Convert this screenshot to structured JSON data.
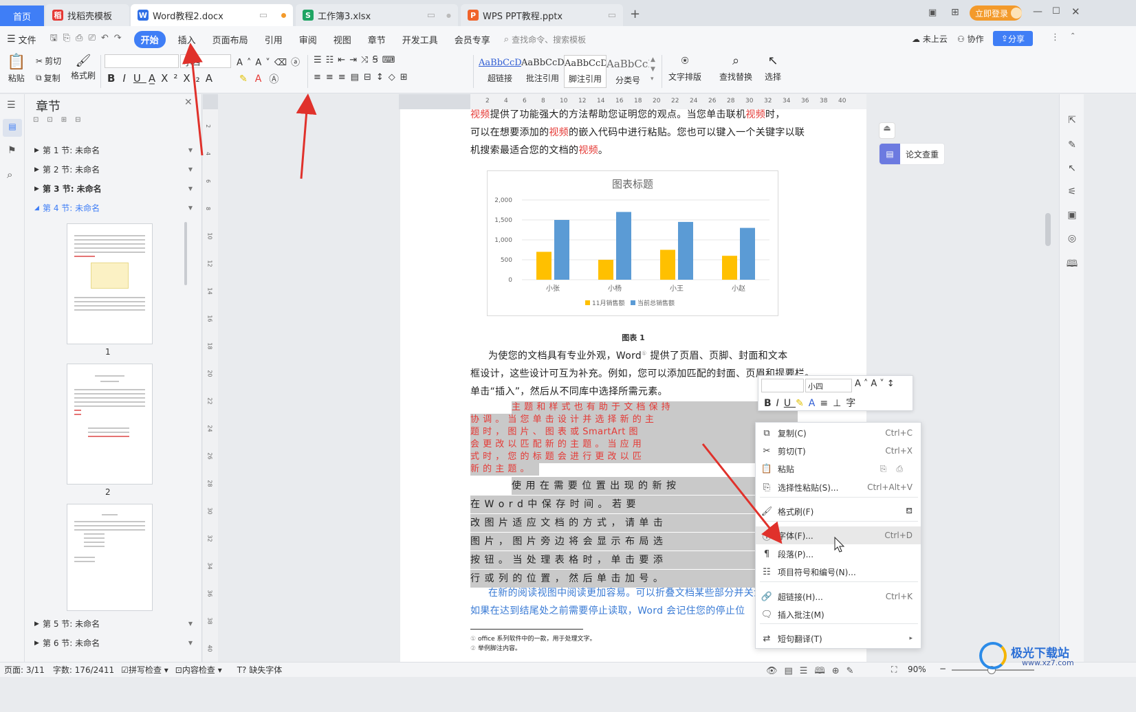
{
  "tabs": [
    {
      "label": "首页"
    },
    {
      "label": "找稻壳模板",
      "icon": "daoke-icon"
    },
    {
      "label": "Word教程2.docx",
      "icon": "wps-writer-icon"
    },
    {
      "label": "工作簿3.xlsx",
      "icon": "wps-sheet-icon"
    },
    {
      "label": "WPS PPT教程.pptx",
      "icon": "wps-ppt-icon"
    }
  ],
  "tabbar_right": {
    "login": "立即登录"
  },
  "menu": {
    "file": "文件",
    "items": [
      "开始",
      "插入",
      "页面布局",
      "引用",
      "审阅",
      "视图",
      "章节",
      "开发工具",
      "会员专享"
    ],
    "search": "查找命令、搜索模板",
    "cloud": "未上云",
    "collab": "协作",
    "share": "分享"
  },
  "ribbon": {
    "paste": "粘贴",
    "cut": "剪切",
    "copy": "复制",
    "format_painter": "格式刷",
    "font_size": "小四",
    "styles": [
      {
        "preview": "AaBbCcDd",
        "label": "超链接"
      },
      {
        "preview": "AaBbCcDd",
        "label": "批注引用"
      },
      {
        "preview": "AaBbCcDd",
        "label": "脚注引用"
      },
      {
        "preview": "AaBbCcI",
        "label": "分类号"
      }
    ],
    "text_layout": "文字排版",
    "find_replace": "查找替换",
    "select": "选择"
  },
  "nav": {
    "title": "章节",
    "chapters": [
      "第 1 节: 未命名",
      "第 2 节: 未命名",
      "第 3 节: 未命名",
      "第 4 节: 未命名",
      "第 5 节: 未命名",
      "第 6 节: 未命名"
    ],
    "pages": [
      "1",
      "2"
    ]
  },
  "ruler_h": [
    "6",
    "4",
    "2",
    "",
    "2",
    "4",
    "6",
    "8",
    "10",
    "12",
    "14",
    "16",
    "18",
    "20",
    "22",
    "24",
    "26",
    "28",
    "30",
    "32",
    "34",
    "36",
    "38",
    "40"
  ],
  "ruler_v": [
    "2",
    "4",
    "6",
    "8",
    "10",
    "12",
    "14",
    "16",
    "18",
    "20",
    "22",
    "24",
    "26",
    "28",
    "30",
    "32",
    "34",
    "36",
    "38",
    "40",
    "42"
  ],
  "doc": {
    "p1": [
      "视频",
      "提供了功能强大的方法帮助您证明您的观点。当您单击联机",
      "视频",
      "时，"
    ],
    "p1b": [
      "可以在想要添加的",
      "视频",
      "的嵌入代码中进行粘贴。您也可以键入一个关键字以联"
    ],
    "p1c": [
      "机搜索最适合您的文档的",
      "视频",
      "。"
    ],
    "caption": "图表 1",
    "p2": "为使您的文档具有专业外观，Word",
    "p2_sup": "①",
    "p2_tail": " 提供了页眉、页脚、封面和文本",
    "p2b": "框设计，这些设计可互为补充。例如，您可以添加匹配的封面、页眉和提要栏。",
    "p2c": "单击“插入”，然后从不同库中选择所需元素。",
    "red_lines": [
      "主 题 和 样 式 也 有 助 于 文 档 保 持",
      "协 调 。 当 您 单 击 设 计 并 选 择 新 的 主",
      "题 时 ， 图 片 、 图 表 或   SmartArt   图",
      "会 更 改 以 匹 配 新 的 主 题 。 当 应 用",
      "式 时 ， 您 的 标 题 会 进 行 更 改 以 匹",
      "新 的 主 题 。"
    ],
    "gray_lines": [
      "使 用 在 需 要 位 置 出 现 的 新 按",
      "在   W o r d   中 保 存 时 间 。 若 要",
      "改 图 片 适 应 文 档 的 方 式 ， 请 单 击",
      "图 片 ， 图 片 旁 边 将 会 显 示 布 局 选",
      "按 钮 。 当 处 理 表 格 时 ， 单 击 要 添",
      "行 或 列 的 位 置 ， 然 后 单 击 加 号 。"
    ],
    "blue_lines": [
      "在新的阅读视图中阅读更加容易。可以折叠文档某些部分并关注所",
      "如果在达到结尾处之前需要停止读取，Word  会记住您的停止位"
    ],
    "footnotes": [
      "office 系列软件中的一款，用于处理文字。",
      "举例脚注内容。"
    ]
  },
  "chart_data": {
    "type": "bar",
    "title": "图表标题",
    "categories": [
      "小张",
      "小杨",
      "小王",
      "小赵"
    ],
    "series": [
      {
        "name": "11月销售额",
        "values": [
          700,
          500,
          750,
          600
        ],
        "color": "#ffc000"
      },
      {
        "name": "当前总销售额",
        "values": [
          1500,
          1700,
          1450,
          1300
        ],
        "color": "#5b9bd5"
      }
    ],
    "yticks": [
      "2,000",
      "1,500",
      "1,000",
      "500",
      "0"
    ],
    "ylim": [
      0,
      2000
    ],
    "grid": true,
    "legend": "bottom"
  },
  "essay_button": "论文查重",
  "mini": {
    "font_size": "小四"
  },
  "context_menu": [
    {
      "icon": "copy-icon",
      "label": "复制(C)",
      "shortcut": "Ctrl+C"
    },
    {
      "icon": "cut-icon",
      "label": "剪切(T)",
      "shortcut": "Ctrl+X"
    },
    {
      "icon": "paste-icon",
      "label": "粘贴",
      "shortcut": ""
    },
    {
      "icon": "paste-special-icon",
      "label": "选择性粘贴(S)...",
      "shortcut": "Ctrl+Alt+V"
    },
    {
      "icon": "format-painter-icon",
      "label": "格式刷(F)",
      "shortcut": ""
    },
    {
      "icon": "font-icon",
      "label": "字体(F)...",
      "shortcut": "Ctrl+D"
    },
    {
      "icon": "paragraph-icon",
      "label": "段落(P)...",
      "shortcut": ""
    },
    {
      "icon": "bullets-icon",
      "label": "项目符号和编号(N)...",
      "shortcut": ""
    },
    {
      "icon": "hyperlink-icon",
      "label": "超链接(H)...",
      "shortcut": "Ctrl+K"
    },
    {
      "icon": "comment-icon",
      "label": "插入批注(M)",
      "shortcut": ""
    },
    {
      "icon": "translate-icon",
      "label": "短句翻译(T)",
      "shortcut": ""
    }
  ],
  "status": {
    "page": "页面: 3/11",
    "words": "字数: 176/2411",
    "spell": "拼写检查",
    "content": "内容检查",
    "missing_font": "缺失字体",
    "zoom": "90%"
  },
  "watermark": "极光下载站",
  "watermark_url": "www.xz7.com",
  "colors": {
    "accent": "#3f7ef6",
    "red_text": "#e53935",
    "blue_text": "#3a7bd5",
    "arrow": "#e0312b"
  }
}
